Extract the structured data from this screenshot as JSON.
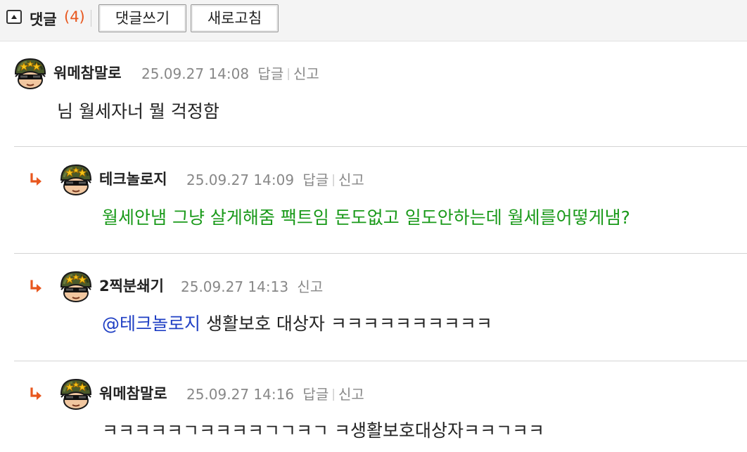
{
  "header": {
    "title": "댓글",
    "count": "(4)",
    "write_button": "댓글쓰기",
    "refresh_button": "새로고침"
  },
  "comments": [
    {
      "author": "워메참말로",
      "timestamp": "25.09.27 14:08",
      "reply_label": "답글",
      "report_label": "신고",
      "text": "님 월세자너 뭘 걱정함"
    },
    {
      "author": "테크놀로지",
      "timestamp": "25.09.27 14:09",
      "reply_label": "답글",
      "report_label": "신고",
      "text": "월세안냄 그냥 살게해줌 팩트임 돈도없고 일도안하는데 월세를어떻게냄?"
    },
    {
      "author": "2찍분쇄기",
      "timestamp": "25.09.27 14:13",
      "report_label": "신고",
      "mention": "@테크놀로지",
      "text": " 생활보호 대상자 ㅋㅋㅋㅋㅋㅋㅋㅋㅋㅋ"
    },
    {
      "author": "워메참말로",
      "timestamp": "25.09.27 14:16",
      "reply_label": "답글",
      "report_label": "신고",
      "text": "ㅋㅋㅋㅋㅋㄱㅋㅋㅋㅋㄱㄱㅋㄱ ㅋ생활보호대상자ㅋㅋㄱㅋㅋ"
    }
  ],
  "colors": {
    "accent_orange": "#e8571e",
    "reply_green": "#1a9a1a",
    "mention_blue": "#1f3fc4",
    "meta_gray": "#888888"
  },
  "icons": {
    "collapse": "caret-up-box-icon",
    "reply_arrow": "reply-arrow-icon",
    "avatar": "soldier-avatar-icon"
  }
}
